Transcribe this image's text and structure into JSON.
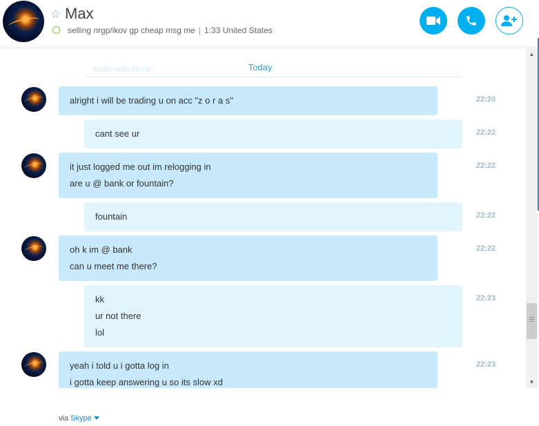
{
  "header": {
    "title": "Max",
    "status": "selling nrgp/ikov gp cheap msg me",
    "local_time": "1:33 United States",
    "icons": {
      "favorite": "star-outline-icon",
      "presence": "online-ring-icon",
      "video": "video-camera-icon",
      "call": "phone-icon",
      "add": "add-person-icon"
    },
    "accent_color": "#00aff0"
  },
  "chat": {
    "divider_label": "Today",
    "faded_message": "trade with lilmar",
    "messages": [
      {
        "from": "contact",
        "lines": [
          "alright i will be trading u on acc \"z o r a s\""
        ],
        "time": "22:20"
      },
      {
        "from": "me",
        "lines": [
          "cant see ur"
        ],
        "time": "22:22"
      },
      {
        "from": "contact",
        "lines": [
          "it just logged me out im relogging in",
          "are u @ bank or fountain?"
        ],
        "time": "22:22"
      },
      {
        "from": "me",
        "lines": [
          "fountain"
        ],
        "time": "22:22"
      },
      {
        "from": "contact",
        "lines": [
          "oh k im @ bank",
          "can u meet me there?"
        ],
        "time": "22:22"
      },
      {
        "from": "me",
        "lines": [
          "kk",
          "ur not there",
          "lol"
        ],
        "time": "22:23"
      },
      {
        "from": "contact",
        "lines": [
          "yeah i told u i gotta log in",
          "i gotta keep answering u so its slow xd"
        ],
        "time": "22:23"
      }
    ],
    "colors": {
      "incoming_bubble": "#c7e9fb",
      "outgoing_bubble": "#e2f4fd",
      "timestamp": "#9ab9cc"
    }
  },
  "footer": {
    "via_label": "via",
    "service_label": "Skype"
  }
}
